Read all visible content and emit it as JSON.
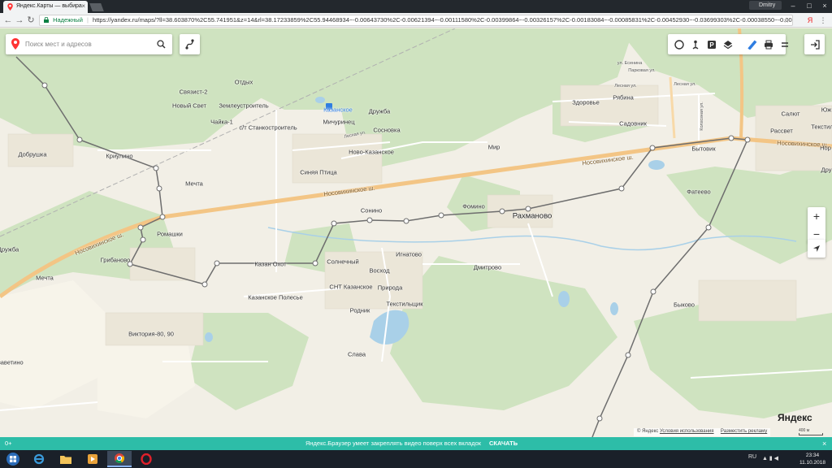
{
  "browser": {
    "tab_title": "Яндекс.Карты — выбира",
    "user_name": "Dmitry",
    "secure_label": "Надежный",
    "url": "https://yandex.ru/maps/?ll=38.603870%2C55.741951&z=14&rl=38.17233859%2C55.94468934~-0.00643730%2C-0.00621394~-0.00111580%2C-0.00399864~-0.00326157%2C-0.00183084~-0.00085831%2C-0.00452930~-0.03699303%2C-0.00038550~-0.00583649%",
    "colors": {
      "secure": "#0b8043",
      "tabbar": "#23282d"
    }
  },
  "map": {
    "search_placeholder": "Поиск мест и адресов",
    "toolbar_icons": [
      "traffic-icon",
      "panorama-icon",
      "parking-icon",
      "layers-icon",
      "ruler-icon",
      "print-icon",
      "menu-icon"
    ],
    "labels": {
      "otdykh": "Отдых",
      "svyazist": "Связист-2",
      "noviy_svet": "Новый Свет",
      "zemleustroitel": "Землеустроитель",
      "chaika": "Чайка-1",
      "st_stankostroitel": "с/т Станкостроитель",
      "kazanskoe_station": "Казанское",
      "druzhba_n": "Дружба",
      "michurinec": "Мичуринец",
      "sosnovka": "Сосновка",
      "novo_kazanskoe": "Ново-Казанское",
      "mir": "Мир",
      "dobrushka": "Добрушка",
      "kriulino": "Криулино",
      "sinyaya_ptica": "Синяя Птица",
      "mechta_n": "Мечта",
      "nosovikhinskoe_1": "Носовихинское ш.",
      "nosovikhinskoe_2": "Носовихинское ш.",
      "nosovikhinskoe_3": "Носовихинское ш.",
      "nosovikhinskoe_4": "Носовихинское ш.",
      "sonino": "Сонино",
      "fomino": "Фомино",
      "rakhmanovo": "Рахманово",
      "romashki": "Ромашки",
      "druzhba_w": "Дружба",
      "gribanovo": "Грибаново",
      "kazan_okhot": "Казан Охот",
      "solnechniy": "Солнечный",
      "ignatovo": "Игнатово",
      "voskhod": "Восход",
      "dmitrovo": "Дмитрово",
      "mechta_s": "Мечта",
      "snt_kazanskoe": "СНТ Казанское",
      "priroda": "Природа",
      "kazanskoe_polesye": "Казанское Полесье",
      "tekstilshchik": "Текстильщик",
      "rodnik": "Родник",
      "viktoriya": "Виктория-80, 90",
      "slavava": "Слава",
      "zavetino": "заветино",
      "zdorovye": "Здоровье",
      "ryabina": "Рябина",
      "sadovnik": "Садовник",
      "bytovik": "Бытовик",
      "fateevo": "Фатеево",
      "salyut": "Салют",
      "rassvet": "Рассвет",
      "tekstil": "Текстил",
      "yuzh": "Юж",
      "byokovo": "Быково",
      "parkovaya": "Парковая ул.",
      "esenina": "ул. Есенина",
      "lesnaya_1": "Лесная ул.",
      "lesnaya_2": "Лесная ул.",
      "lesnaya_3": "Лесная ул.",
      "kolkhoznaya": "Колхозная ул.",
      "nor": "Нор",
      "dru": "Дру"
    },
    "attribution": {
      "copyright": "© Яндекс",
      "terms": "Условия использования",
      "ads": "Разместить рекламу",
      "scale": "400 м",
      "logo": "Яндекс"
    }
  },
  "notification": {
    "left": "0+",
    "message": "Яндекс.Браузер умеет закреплять видео поверх всех вкладок",
    "action": "СКАЧАТЬ",
    "close": "×"
  },
  "taskbar": {
    "lang": "RU",
    "time": "23:34",
    "date": "11.10.2018"
  }
}
